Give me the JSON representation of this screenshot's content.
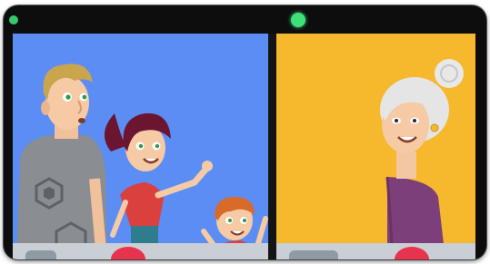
{
  "colors": {
    "device_frame": "#0d0d0d",
    "camera_indicator": "#3ee07a",
    "left_background": "#5b8df5",
    "right_background": "#f6b82c",
    "control_bar": "#c9cfd5",
    "end_call_button": "#e8334f"
  },
  "icons": {
    "camera": "camera-indicator-icon",
    "end_call_left": "end-call-icon",
    "end_call_right": "end-call-icon"
  }
}
